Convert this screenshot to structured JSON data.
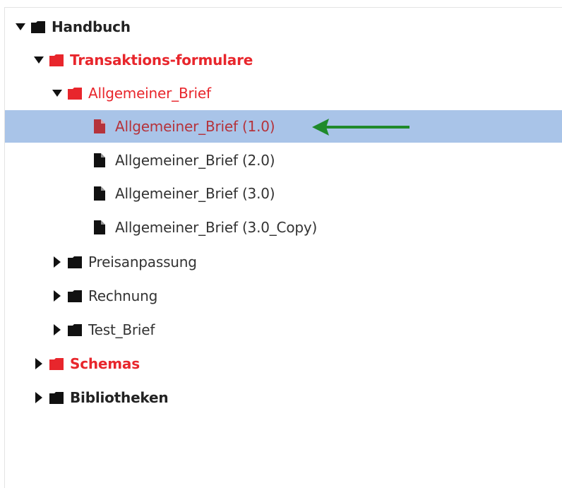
{
  "tree": {
    "items": [
      {
        "label": "Handbuch",
        "color": "#222222"
      },
      {
        "label": "Transaktions-formulare",
        "color": "#e8262c"
      },
      {
        "label": "Allgemeiner_Brief",
        "color": "#e8262c"
      },
      {
        "label": "Allgemeiner_Brief (1.0)",
        "color": "#b5333b"
      },
      {
        "label": "Allgemeiner_Brief (2.0)",
        "color": "#333333"
      },
      {
        "label": "Allgemeiner_Brief (3.0)",
        "color": "#333333"
      },
      {
        "label": "Allgemeiner_Brief (3.0_Copy)",
        "color": "#333333"
      },
      {
        "label": "Preisanpassung",
        "color": "#333333"
      },
      {
        "label": "Rechnung",
        "color": "#333333"
      },
      {
        "label": "Test_Brief",
        "color": "#333333"
      },
      {
        "label": "Schemas",
        "color": "#e8262c"
      },
      {
        "label": "Bibliotheken",
        "color": "#222222"
      }
    ],
    "selection_color": "#a9c4e8",
    "annotation_arrow_color": "#1f8a2a"
  }
}
